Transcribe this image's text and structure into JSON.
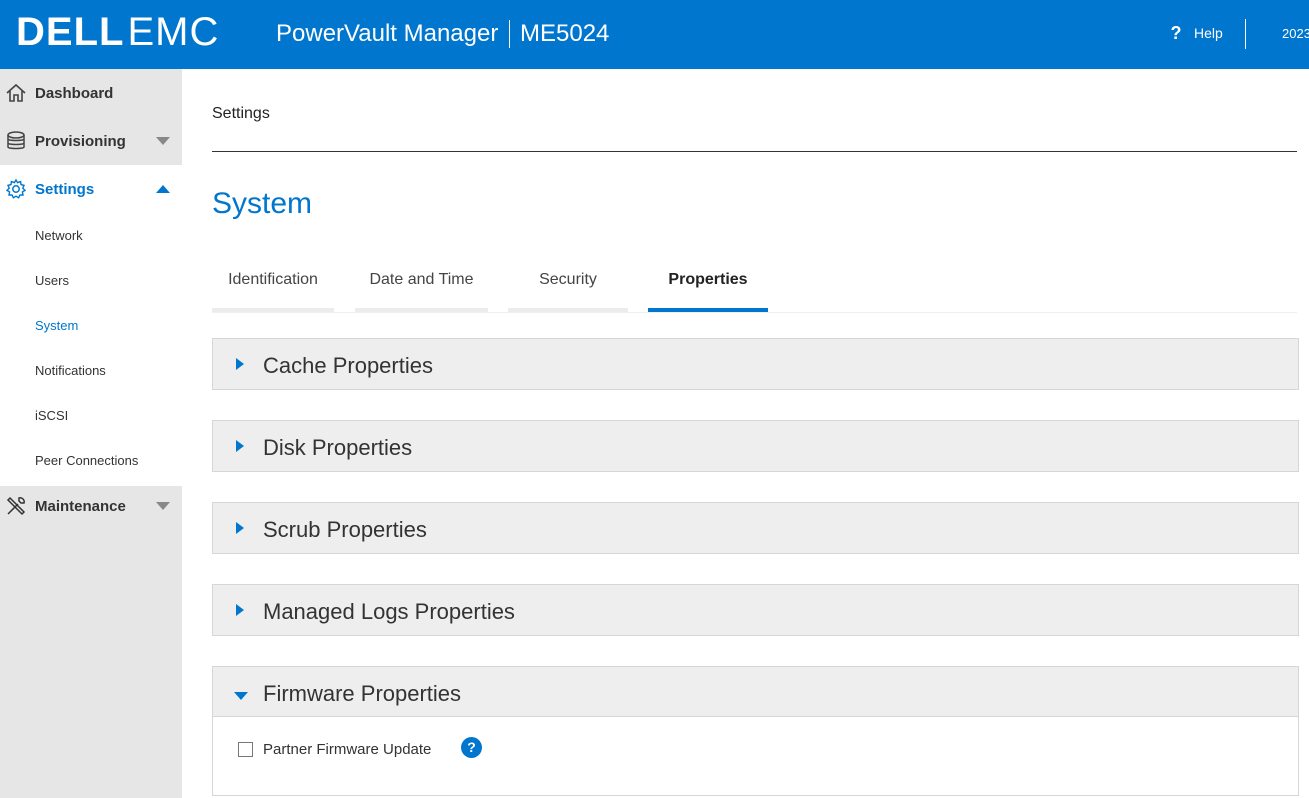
{
  "header": {
    "logo_dell": "DELL",
    "logo_emc": "EMC",
    "app_title": "PowerVault Manager",
    "model": "ME5024",
    "help_label": "Help",
    "date_partial": "2023"
  },
  "sidebar": {
    "items": [
      {
        "label": "Dashboard",
        "icon": "home-icon"
      },
      {
        "label": "Provisioning",
        "icon": "database-icon"
      },
      {
        "label": "Settings",
        "icon": "gear-icon"
      },
      {
        "label": "Maintenance",
        "icon": "tools-icon"
      }
    ],
    "settings_sub": [
      "Network",
      "Users",
      "System",
      "Notifications",
      "iSCSI",
      "Peer Connections"
    ],
    "active_item": "Settings",
    "active_sub": "System"
  },
  "main": {
    "breadcrumb": "Settings",
    "page_title": "System",
    "tabs": [
      "Identification",
      "Date and Time",
      "Security",
      "Properties"
    ],
    "active_tab": "Properties",
    "panels": [
      "Cache Properties",
      "Disk Properties",
      "Scrub Properties",
      "Managed Logs Properties",
      "Firmware Properties"
    ],
    "firmware": {
      "checkbox_label": "Partner Firmware Update",
      "checked": false,
      "info_glyph": "?"
    }
  },
  "colors": {
    "brand_blue": "#0076ce",
    "sidebar_bg": "#e6e6e6",
    "panel_bg": "#eeeeee"
  }
}
